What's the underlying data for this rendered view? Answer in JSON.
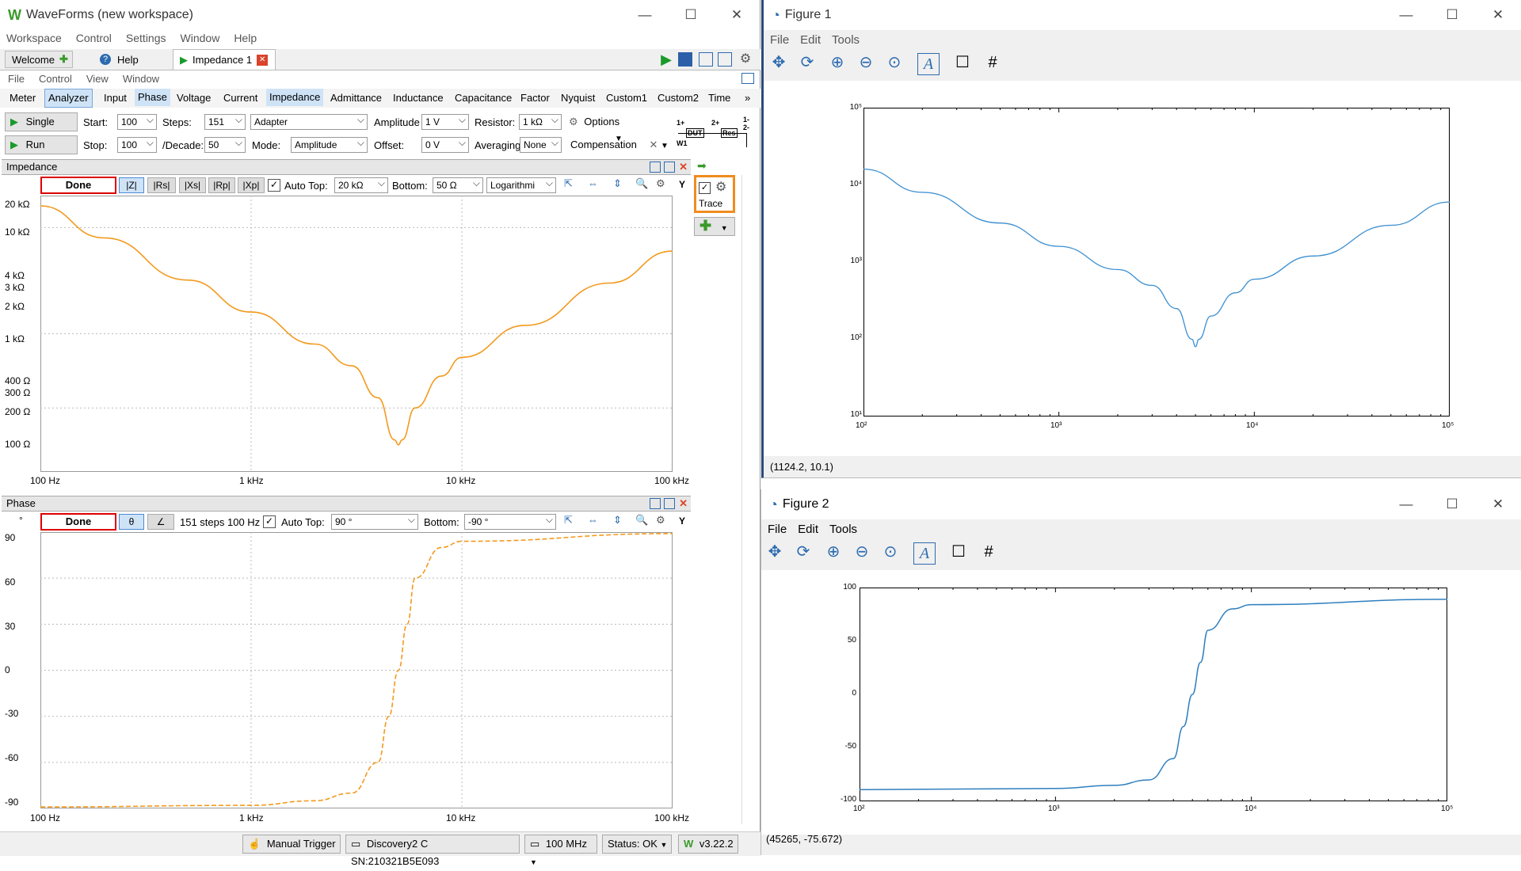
{
  "waveforms": {
    "title": "WaveForms (new workspace)",
    "menu": [
      "Workspace",
      "Control",
      "Settings",
      "Window",
      "Help"
    ],
    "tabs": [
      {
        "label": "Welcome"
      },
      {
        "label": "Help"
      },
      {
        "label": "Impedance 1"
      }
    ],
    "submenu": [
      "File",
      "Control",
      "View",
      "Window"
    ],
    "mode_tabs": [
      "Meter",
      "Analyzer",
      "Input",
      "Phase",
      "Voltage",
      "Current",
      "Impedance",
      "Admittance",
      "Inductance",
      "Capacitance",
      "Factor",
      "Nyquist",
      "Custom1",
      "Custom2",
      "Time"
    ],
    "controls": {
      "single_label": "Single",
      "run_label": "Run",
      "start_label": "Start:",
      "start_value": "100",
      "stop_label": "Stop:",
      "stop_value": "100",
      "steps_label": "Steps:",
      "steps_value": "151",
      "decade_label": "/Decade:",
      "decade_value": "50",
      "adapter_value": "Adapter",
      "mode_label": "Mode:",
      "mode_value": "Amplitude",
      "amplitude_label": "Amplitude",
      "amplitude_value": "1 V",
      "offset_label": "Offset:",
      "offset_value": "0 V",
      "resistor_label": "Resistor:",
      "resistor_value": "1 kΩ",
      "averaging_label": "Averaging",
      "averaging_value": "None",
      "options_label": "Options",
      "compensation_label": "Compensation",
      "circuit": {
        "p1": "1+",
        "p2": "2+",
        "m1": "1-",
        "m2": "2-",
        "dut": "DUT",
        "res": "Res",
        "w1": "W1"
      }
    },
    "impedance_panel": {
      "title": "Impedance",
      "status": "Done",
      "traces": [
        "|Z|",
        "|Rs|",
        "|Xs|",
        "|Rp|",
        "|Xp|"
      ],
      "auto_top_label": "Auto Top:",
      "top_value": "20 kΩ",
      "bottom_label": "Bottom:",
      "bottom_value": "50 Ω",
      "scale_value": "Logarithmi",
      "y_button": "Y",
      "y_ticks": [
        "20 kΩ",
        "10 kΩ",
        "4 kΩ",
        "3 kΩ",
        "2 kΩ",
        "1 kΩ",
        "400 Ω",
        "300 Ω",
        "200 Ω",
        "100 Ω"
      ],
      "x_ticks": [
        "100 Hz",
        "1 kHz",
        "10 kHz",
        "100 kHz"
      ]
    },
    "phase_panel": {
      "title": "Phase",
      "status": "Done",
      "unit": "°",
      "trace": "θ",
      "info": "151 steps 100 Hz",
      "auto_top_label": "Auto Top:",
      "top_value": "90 °",
      "bottom_label": "Bottom:",
      "bottom_value": "-90 °",
      "y_button": "Y",
      "y_ticks": [
        "90",
        "60",
        "30",
        "0",
        "-30",
        "-60",
        "-90"
      ],
      "x_ticks": [
        "100 Hz",
        "1 kHz",
        "10 kHz",
        "100 kHz"
      ]
    },
    "trace_label": "Trace",
    "status_bar": {
      "trigger": "Manual Trigger",
      "device": "Discovery2 C SN:210321B5E093",
      "clock": "100 MHz",
      "status": "Status: OK",
      "version": "v3.22.2"
    },
    "colors": {
      "trace": "#f39a1e",
      "accent": "#2c6bb0",
      "done_border": "#dd0000"
    }
  },
  "figure1": {
    "title": "Figure 1",
    "menu": [
      "File",
      "Edit",
      "Tools"
    ],
    "coords": "(1124.2, 10.1)",
    "x_ticks": [
      "10²",
      "10³",
      "10⁴",
      "10⁵"
    ],
    "y_ticks": [
      "10⁵",
      "10⁴",
      "10³",
      "10²",
      "10¹"
    ]
  },
  "figure2": {
    "title": "Figure 2",
    "menu": [
      "File",
      "Edit",
      "Tools"
    ],
    "coords": "(45265, -75.672)",
    "x_ticks": [
      "10²",
      "10³",
      "10⁴",
      "10⁵"
    ],
    "y_ticks": [
      "100",
      "50",
      "0",
      "-50",
      "-100"
    ]
  },
  "chart_data": [
    {
      "type": "line",
      "name_ref": "impedance",
      "x": [
        100,
        200,
        500,
        1000,
        2000,
        3000,
        4000,
        4800,
        5000,
        5200,
        6000,
        8000,
        10000,
        20000,
        50000,
        100000
      ],
      "y": [
        16000,
        8000,
        3200,
        1600,
        800,
        500,
        250,
        100,
        90,
        100,
        200,
        400,
        600,
        1200,
        3000,
        6000
      ],
      "xscale": "log",
      "yscale": "log",
      "xlim": [
        100,
        100000
      ],
      "ylim": [
        50,
        20000
      ]
    },
    {
      "type": "line",
      "name_ref": "phase",
      "x": [
        100,
        1000,
        2000,
        3000,
        4000,
        4500,
        5000,
        5500,
        6000,
        8000,
        10000,
        100000
      ],
      "y": [
        -89,
        -88,
        -85,
        -80,
        -60,
        -30,
        0,
        30,
        60,
        80,
        84,
        89
      ],
      "xscale": "log",
      "xlim": [
        100,
        100000
      ],
      "ylim": [
        -90,
        90
      ]
    },
    {
      "type": "line",
      "name_ref": "figure1",
      "x": [
        100,
        200,
        500,
        1000,
        2000,
        3000,
        4000,
        4800,
        5000,
        5200,
        6000,
        8000,
        10000,
        20000,
        50000,
        100000
      ],
      "y": [
        16000,
        8000,
        3200,
        1600,
        800,
        500,
        250,
        100,
        80,
        100,
        200,
        400,
        600,
        1200,
        3000,
        6000
      ],
      "xscale": "log",
      "yscale": "log",
      "xlim": [
        100,
        100000
      ],
      "ylim": [
        10,
        100000
      ]
    },
    {
      "type": "line",
      "name_ref": "figure2",
      "x": [
        100,
        1000,
        2000,
        3000,
        4000,
        4500,
        5000,
        5500,
        6000,
        8000,
        10000,
        100000
      ],
      "y": [
        -89,
        -88,
        -85,
        -80,
        -60,
        -30,
        0,
        30,
        60,
        80,
        84,
        89
      ],
      "xscale": "log",
      "xlim": [
        100,
        100000
      ],
      "ylim": [
        -100,
        100
      ]
    }
  ]
}
